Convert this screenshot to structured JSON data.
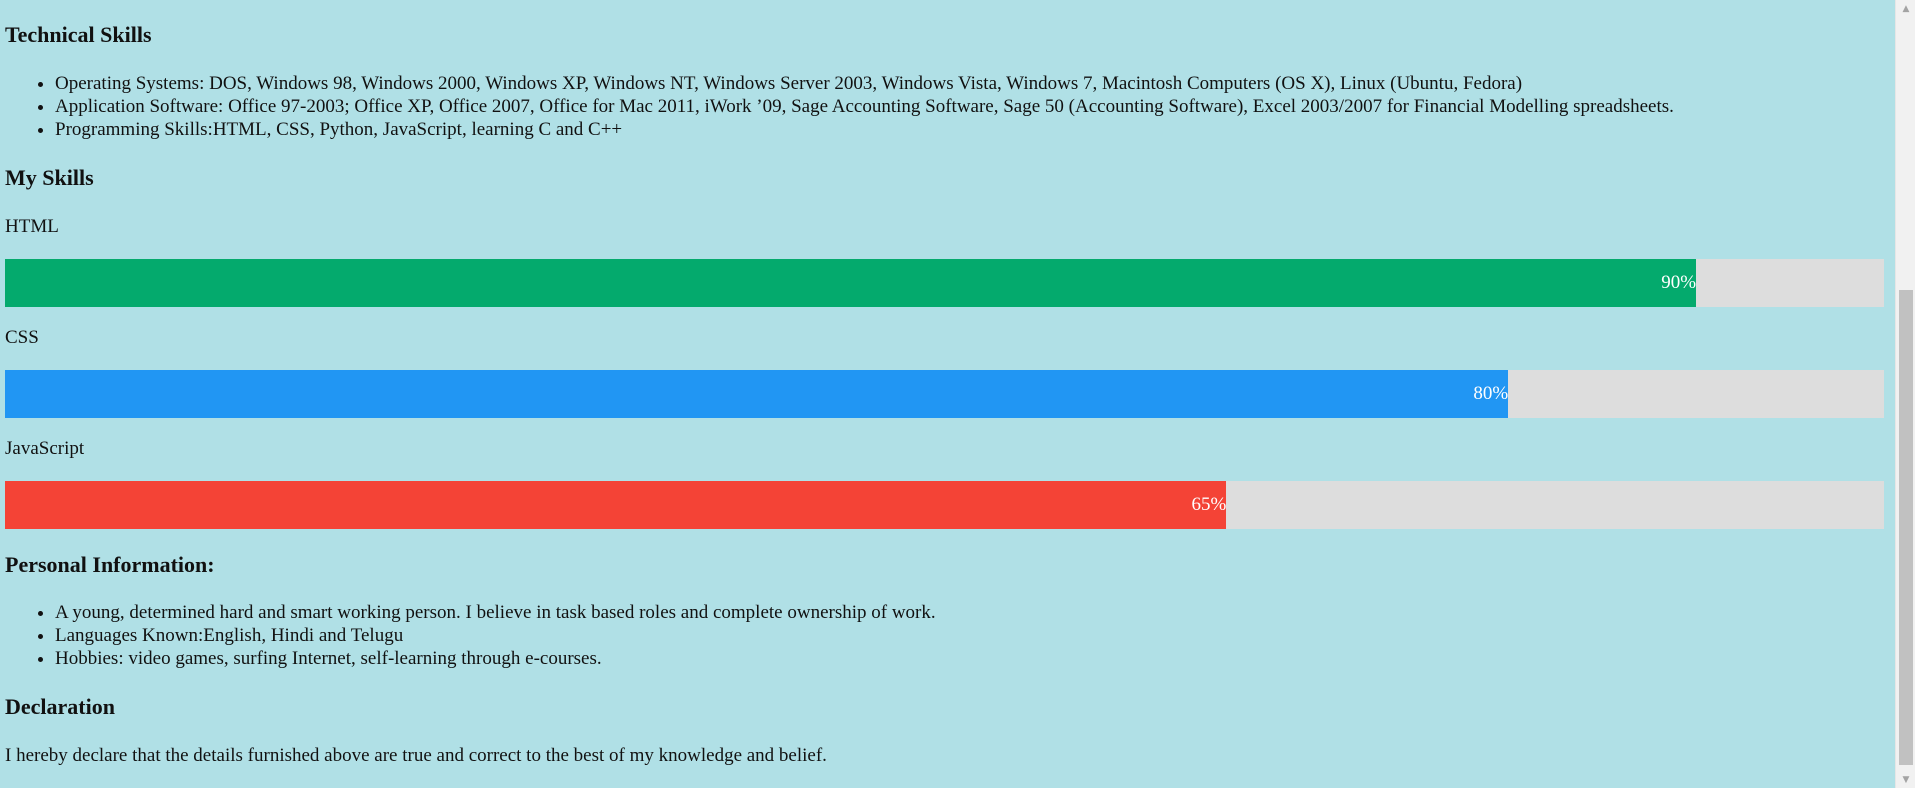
{
  "technical_skills": {
    "heading": "Technical Skills",
    "items": [
      "Operating Systems: DOS, Windows 98, Windows 2000, Windows XP, Windows NT, Windows Server 2003, Windows Vista, Windows 7, Macintosh Computers (OS X), Linux (Ubuntu, Fedora)",
      "Application Software: Office 97-2003; Office XP, Office 2007, Office for Mac 2011, iWork ’09, Sage Accounting Software, Sage 50 (Accounting Software), Excel 2003/2007 for Financial Modelling spreadsheets.",
      "Programming Skills:HTML, CSS, Python, JavaScript, learning C and C++"
    ]
  },
  "my_skills": {
    "heading": "My Skills",
    "skills": [
      {
        "name": "HTML",
        "percent": 90,
        "label": "90%",
        "color": "#04aa6d"
      },
      {
        "name": "CSS",
        "percent": 80,
        "label": "80%",
        "color": "#2196f3"
      },
      {
        "name": "JavaScript",
        "percent": 65,
        "label": "65%",
        "color": "#f44336"
      }
    ],
    "track_color": "#dddddd"
  },
  "personal_information": {
    "heading": "Personal Information:",
    "items": [
      "A young, determined hard and smart working person. I believe in task based roles and complete ownership of work.",
      "Languages Known:English, Hindi and Telugu",
      "Hobbies: video games, surfing Internet, self-learning through e-courses."
    ]
  },
  "declaration": {
    "heading": "Declaration",
    "text": "I hereby declare that the details furnished above are true and correct to the best of my knowledge and belief."
  },
  "scrollbar": {
    "up_icon": "arrow-up-icon",
    "down_icon": "arrow-down-icon",
    "position_fraction": 0.99
  },
  "theme": {
    "page_background": "#b0e0e6"
  }
}
